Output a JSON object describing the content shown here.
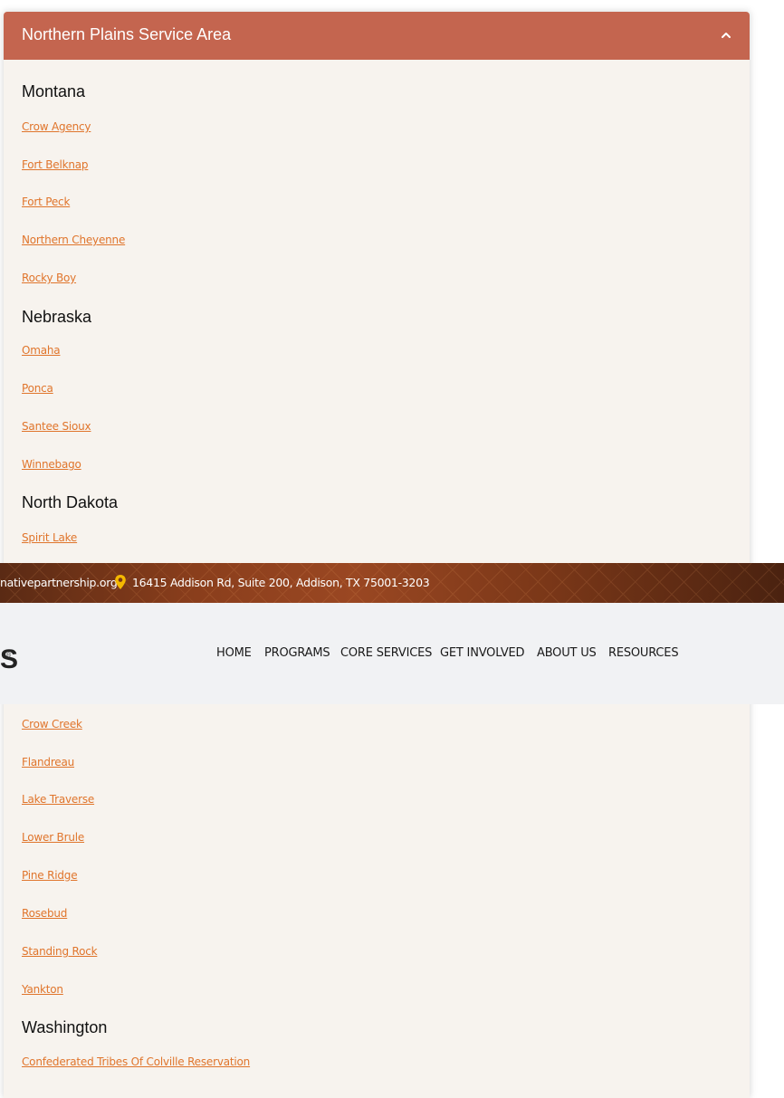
{
  "panel": {
    "title": "Northern Plains Service Area",
    "toggle_icon": "chevron-up-icon"
  },
  "sections": {
    "montana": {
      "heading": "Montana",
      "links": [
        "Crow Agency",
        "Fort Belknap",
        "Fort Peck",
        "Northern Cheyenne",
        "Rocky Boy"
      ]
    },
    "nebraska": {
      "heading": "Nebraska",
      "links": [
        "Omaha",
        "Ponca",
        "Santee Sioux",
        "Winnebago"
      ]
    },
    "north_dakota": {
      "heading": "North Dakota",
      "links": [
        "Spirit Lake"
      ]
    },
    "south_dakota": {
      "links": [
        "Crow Creek",
        "Flandreau",
        "Lake Traverse",
        "Lower Brule",
        "Pine Ridge",
        "Rosebud",
        "Standing Rock",
        "Yankton"
      ]
    },
    "washington": {
      "heading": "Washington",
      "links": [
        "Confederated Tribes Of Colville Reservation"
      ]
    }
  },
  "topbar": {
    "email": "nativepartnership.org",
    "address": "16415 Addison Rd, Suite 200, Addison, TX 75001-3203",
    "pin_icon": "location-pin-icon"
  },
  "navbar": {
    "logo_fragment": "S",
    "logo_mark": "®",
    "items": [
      "HOME",
      "PROGRAMS",
      "CORE SERVICES",
      "GET INVOLVED",
      "ABOUT US",
      "RESOURCES"
    ]
  },
  "colors": {
    "header_bg": "#c4654f",
    "link": "#e0752c",
    "panel_bg": "#f7f3ee",
    "pin": "#f5b800"
  }
}
